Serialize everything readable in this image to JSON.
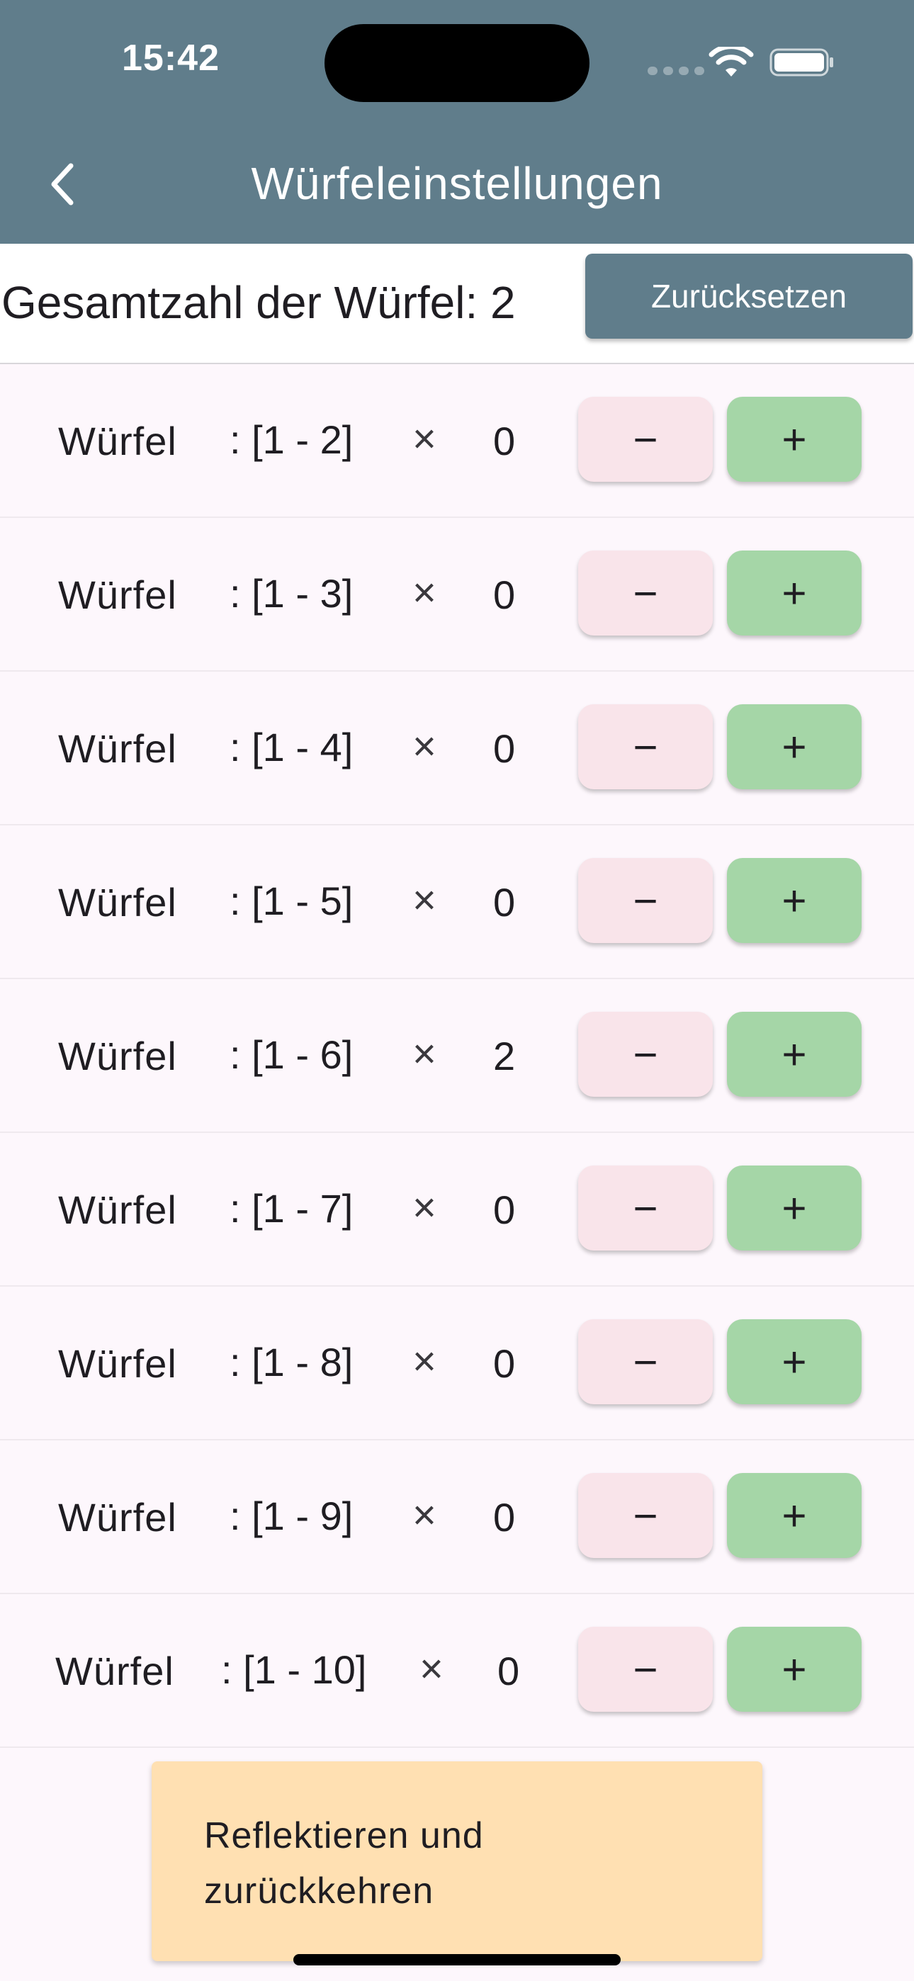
{
  "status_bar": {
    "time": "15:42"
  },
  "header": {
    "title": "Würfeleinstellungen",
    "back_icon": "chevron-left-icon"
  },
  "summary": {
    "total_label": "Gesamtzahl der Würfel: 2",
    "reset_label": "Zurücksetzen"
  },
  "dice": [
    {
      "name": "Würfel",
      "range": ": [1 - 2]",
      "times": "×",
      "count": "0",
      "minus": "−",
      "plus": "+"
    },
    {
      "name": "Würfel",
      "range": ": [1 - 3]",
      "times": "×",
      "count": "0",
      "minus": "−",
      "plus": "+"
    },
    {
      "name": "Würfel",
      "range": ": [1 - 4]",
      "times": "×",
      "count": "0",
      "minus": "−",
      "plus": "+"
    },
    {
      "name": "Würfel",
      "range": ": [1 - 5]",
      "times": "×",
      "count": "0",
      "minus": "−",
      "plus": "+"
    },
    {
      "name": "Würfel",
      "range": ": [1 - 6]",
      "times": "×",
      "count": "2",
      "minus": "−",
      "plus": "+"
    },
    {
      "name": "Würfel",
      "range": ": [1 - 7]",
      "times": "×",
      "count": "0",
      "minus": "−",
      "plus": "+"
    },
    {
      "name": "Würfel",
      "range": ": [1 - 8]",
      "times": "×",
      "count": "0",
      "minus": "−",
      "plus": "+"
    },
    {
      "name": "Würfel",
      "range": ": [1 - 9]",
      "times": "×",
      "count": "0",
      "minus": "−",
      "plus": "+"
    },
    {
      "name": "Würfel",
      "range": ": [1 - 10]",
      "times": "×",
      "count": "0",
      "minus": "−",
      "plus": "+"
    }
  ],
  "footer": {
    "reflect_label": "Reflektieren und zurückkehren"
  },
  "colors": {
    "app_bar": "#607d8b",
    "background": "#fdf7fc",
    "minus_button": "#f9e4ea",
    "plus_button": "#a5d6a7",
    "reflect_button": "#ffe0b2"
  }
}
